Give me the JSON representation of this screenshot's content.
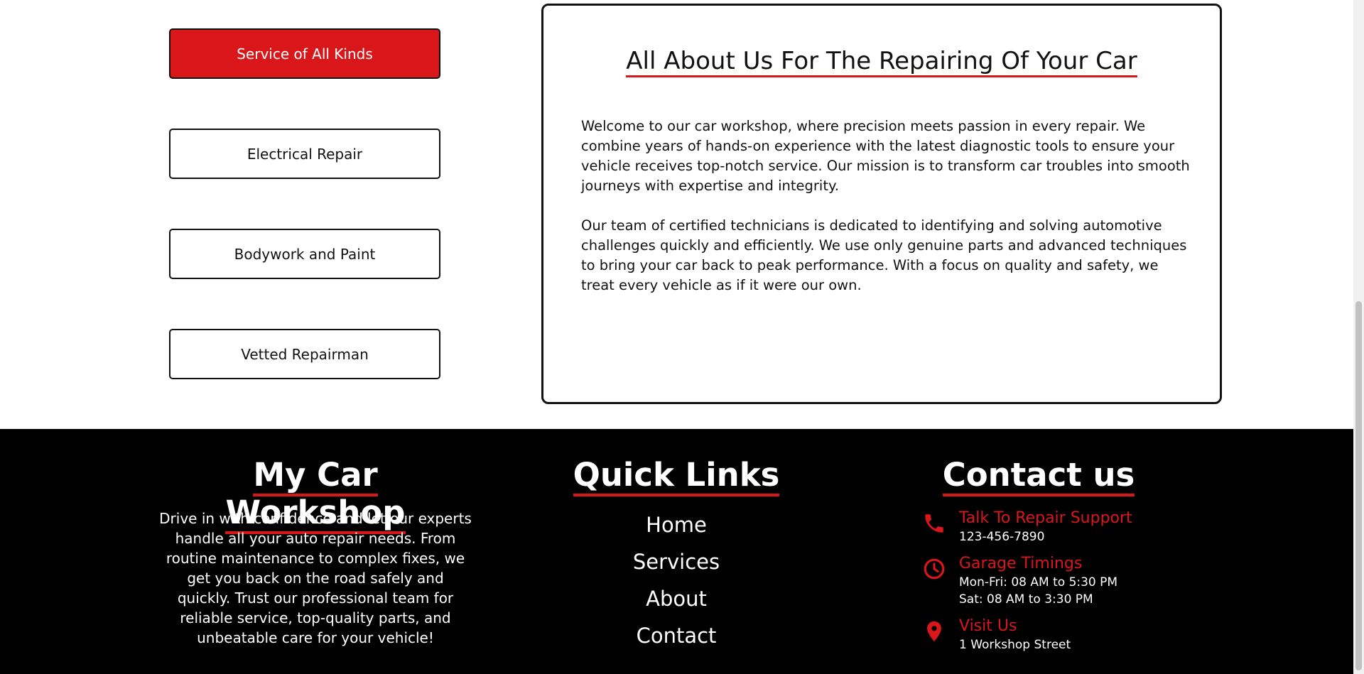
{
  "services": {
    "tabs": [
      "Service of All Kinds",
      "Electrical Repair",
      "Bodywork and Paint",
      "Vetted Repairman"
    ],
    "active_tab": "Service of All Kinds"
  },
  "about": {
    "title": "All About Us For The Repairing Of Your Car",
    "paragraphs": [
      "Welcome to our car workshop, where precision meets passion in every repair. We combine years of hands-on experience with the latest diagnostic tools to ensure your vehicle receives top-notch service. Our mission is to transform car troubles into smooth journeys with expertise and integrity.",
      "Our team of certified technicians is dedicated to identifying and solving automotive challenges quickly and efficiently. We use only genuine parts and advanced techniques to bring your car back to peak performance. With a focus on quality and safety, we treat every vehicle as if it were our own."
    ]
  },
  "footer": {
    "brand_title": "My Car Workshop",
    "brand_text": "Drive in with confidence and let our experts handle all your auto repair needs. From routine maintenance to complex fixes, we get you back on the road safely and quickly. Trust our professional team for reliable service, top-quality parts, and unbeatable care for your vehicle!",
    "links_title": "Quick Links",
    "links": [
      "Home",
      "Services",
      "About",
      "Contact"
    ],
    "contact_title": "Contact us",
    "contact": {
      "support_label": "Talk To Repair Support",
      "support_phone": "123-456-7890",
      "timings_label": "Garage Timings",
      "timings_weekday": "Mon-Fri: 08 AM to 5:30 PM",
      "timings_saturday": "Sat: 08 AM to 3:30 PM",
      "visit_label": "Visit Us",
      "visit_address": "1 Workshop Street"
    },
    "icons": [
      "phone-icon",
      "clock-icon",
      "location-pin-icon"
    ]
  },
  "colors": {
    "accent": "#d9171a",
    "footer_bg": "#000000"
  }
}
